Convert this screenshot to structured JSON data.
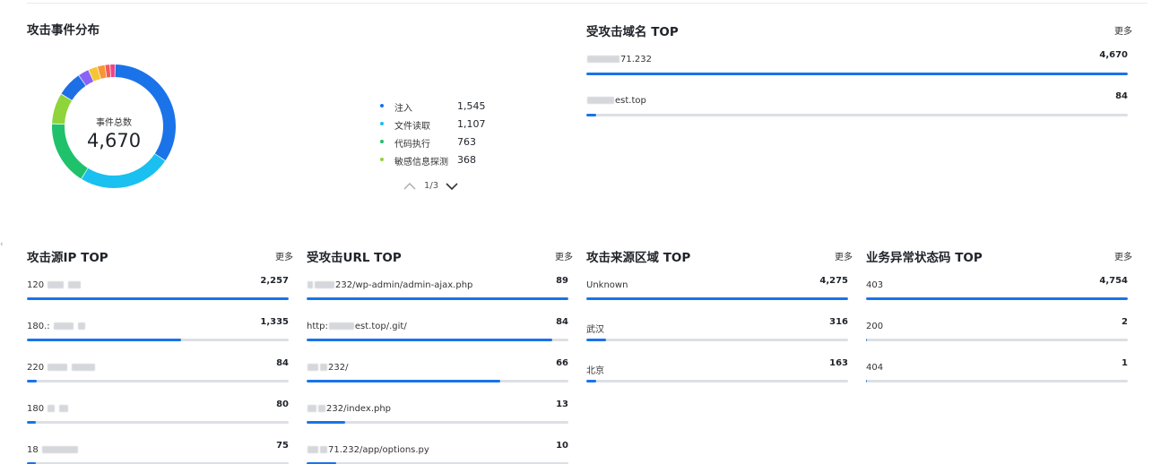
{
  "event_dist": {
    "title": "攻击事件分布",
    "center_label": "事件总数",
    "center_value": "4,670",
    "donut_segments": [
      {
        "value": 1545,
        "color": "#1a73e8"
      },
      {
        "value": 1107,
        "color": "#19c0f0"
      },
      {
        "value": 763,
        "color": "#20c16b"
      },
      {
        "value": 368,
        "color": "#8fd43a"
      },
      {
        "value": 300,
        "color": "#1e6fe6"
      },
      {
        "value": 130,
        "color": "#8a63f5"
      },
      {
        "value": 110,
        "color": "#f7c534"
      },
      {
        "value": 90,
        "color": "#f79636"
      },
      {
        "value": 60,
        "color": "#f25b5b"
      },
      {
        "value": 60,
        "color": "#f04385"
      }
    ],
    "legend": [
      {
        "name": "注入",
        "value": "1,545",
        "color": "#1a73e8"
      },
      {
        "name": "文件读取",
        "value": "1,107",
        "color": "#19c0f0"
      },
      {
        "name": "代码执行",
        "value": "763",
        "color": "#20c16b"
      },
      {
        "name": "敏感信息探测",
        "value": "368",
        "color": "#8fd43a"
      }
    ],
    "pager": "1/3"
  },
  "domain_top": {
    "title": "受攻击域名 TOP",
    "more": "更多",
    "rows": [
      {
        "label": "71.232",
        "value": "4,670",
        "ratio": 1.0
      },
      {
        "label": "est.top",
        "value": "84",
        "ratio": 0.018
      }
    ]
  },
  "ip_top": {
    "title": "攻击源IP TOP",
    "more": "更多",
    "rows": [
      {
        "label": "120",
        "value": "2,257",
        "ratio": 1.0
      },
      {
        "label": "180.:",
        "value": "1,335",
        "ratio": 0.59
      },
      {
        "label": "220",
        "value": "84",
        "ratio": 0.037
      },
      {
        "label": "180",
        "value": "80",
        "ratio": 0.035
      },
      {
        "label": "18",
        "value": "75",
        "ratio": 0.033
      }
    ]
  },
  "url_top": {
    "title": "受攻击URL TOP",
    "more": "更多",
    "rows": [
      {
        "label": "232/wp-admin/admin-ajax.php",
        "value": "89",
        "ratio": 1.0
      },
      {
        "label": "est.top/.git/",
        "prefix": "http:",
        "value": "84",
        "ratio": 0.94
      },
      {
        "label": "232/",
        "value": "66",
        "ratio": 0.74
      },
      {
        "label": "232/index.php",
        "value": "13",
        "ratio": 0.146
      },
      {
        "label": "71.232/app/options.py",
        "value": "10",
        "ratio": 0.112
      }
    ]
  },
  "region_top": {
    "title": "攻击来源区域 TOP",
    "more": "更多",
    "rows": [
      {
        "label": "Unknown",
        "value": "4,275",
        "ratio": 1.0
      },
      {
        "label": "武汉",
        "value": "316",
        "ratio": 0.074
      },
      {
        "label": "北京",
        "value": "163",
        "ratio": 0.038
      }
    ]
  },
  "status_top": {
    "title": "业务异常状态码 TOP",
    "more": "更多",
    "rows": [
      {
        "label": "403",
        "value": "4,754",
        "ratio": 1.0
      },
      {
        "label": "200",
        "value": "2",
        "ratio": 0.0005
      },
      {
        "label": "404",
        "value": "1",
        "ratio": 0.0002
      }
    ]
  }
}
